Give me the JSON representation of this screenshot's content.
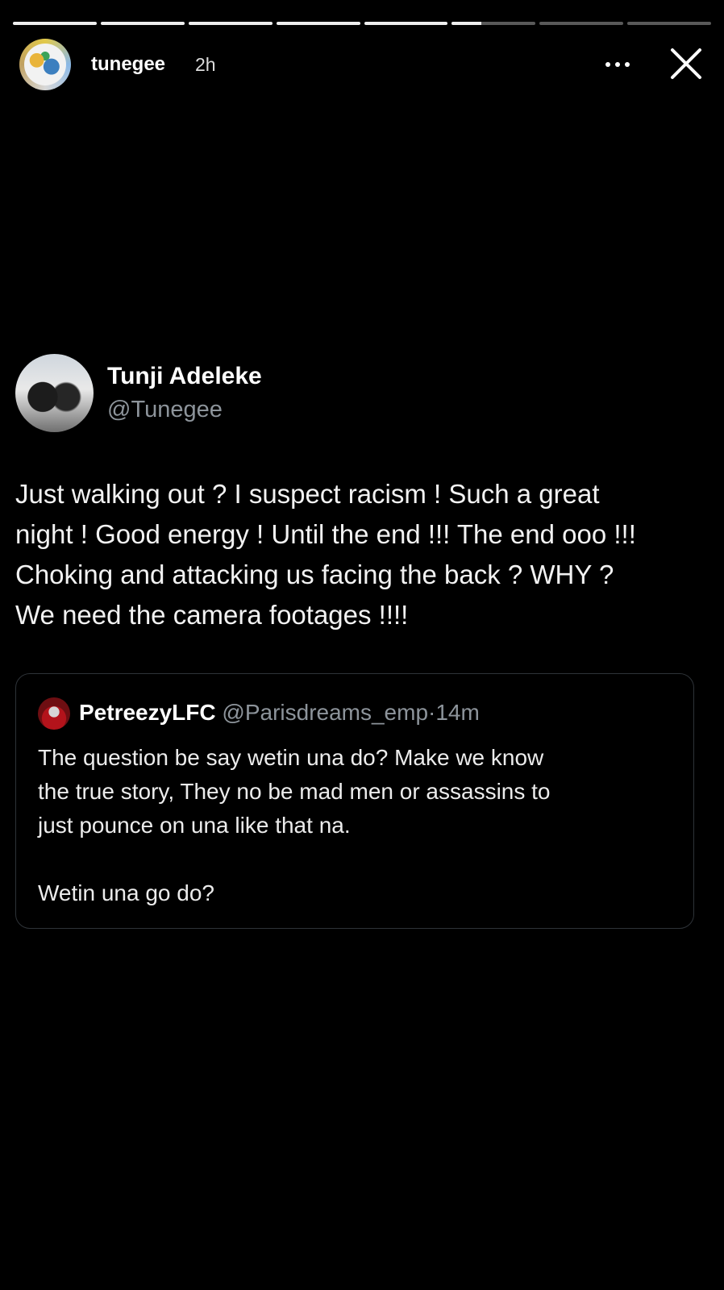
{
  "story": {
    "segments": [
      {
        "progress": 1
      },
      {
        "progress": 1
      },
      {
        "progress": 1
      },
      {
        "progress": 1
      },
      {
        "progress": 1
      },
      {
        "progress": 0.35
      },
      {
        "progress": 0
      },
      {
        "progress": 0
      }
    ],
    "username": "tunegee",
    "time": "2h",
    "icons": {
      "more": "more-horizontal-icon",
      "close": "close-icon"
    }
  },
  "tweet": {
    "name": "Tunji Adeleke",
    "handle": "@Tunegee",
    "text": "Just walking out ? I suspect racism ! Such a great\nnight ! Good energy ! Until the end !!! The end ooo !!!\nChoking and attacking us facing the back ? WHY ?\nWe need the camera footages !!!!"
  },
  "quote": {
    "name": "PetreezyLFC",
    "handle": "@Parisdreams_emp",
    "separator": "·",
    "time": "14m",
    "text": "The question be say wetin una do? Make we know\nthe true story, They no be mad men or assassins to\njust pounce on una like that na.\n\nWetin una go do?"
  },
  "colors": {
    "background": "#000000",
    "muted": "#8d949b",
    "border": "#2e3338"
  }
}
